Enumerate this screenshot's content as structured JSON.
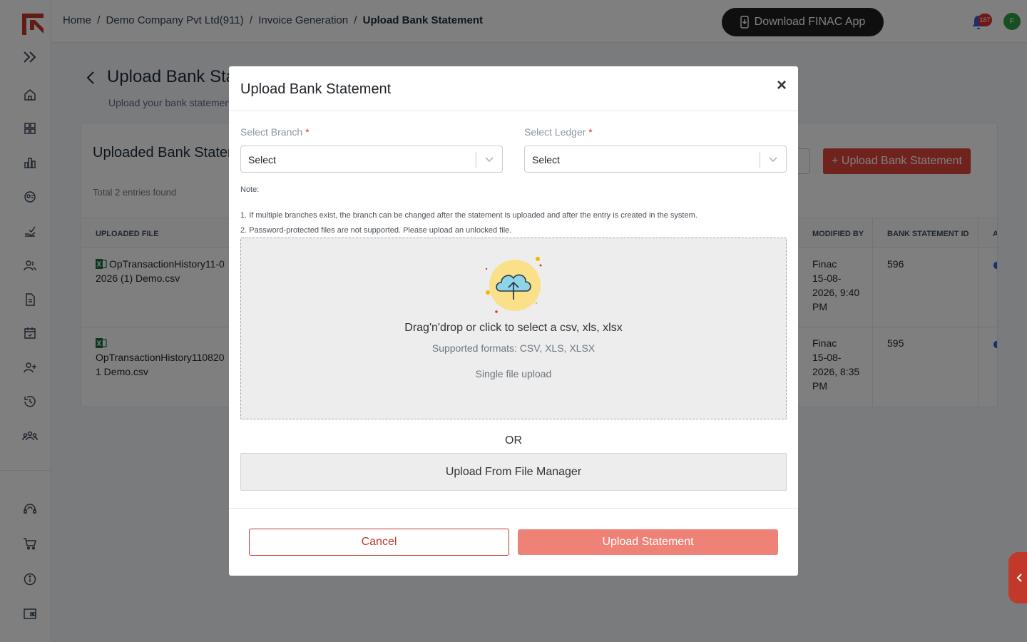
{
  "header": {
    "breadcrumb": [
      {
        "label": "Home"
      },
      {
        "label": "Demo Company Pvt Ltd(911)"
      },
      {
        "label": "Invoice Generation"
      },
      {
        "label": "Upload Bank Statement"
      }
    ],
    "separator": "/",
    "app_button_label": "Download FINAC App",
    "notification_count": "187",
    "avatar_initial": "F"
  },
  "sidebar": {
    "icons": [
      "logo-icon",
      "expand-icon",
      "home-icon",
      "dashboard-icon",
      "reports-icon",
      "accounts-icon",
      "payments-icon",
      "contacts-icon",
      "documents-icon",
      "calendar-icon",
      "add-user-icon",
      "history-icon",
      "team-icon",
      "support-icon",
      "cart-icon",
      "info-icon",
      "wallet-icon"
    ]
  },
  "page": {
    "title": "Upload Bank Sta",
    "subtitle": "Upload your bank statemen",
    "card_title": "Uploaded Bank Stater",
    "entries_count": "Total 2 entries found",
    "upload_button": "+ Upload Bank Statement",
    "columns": {
      "uploaded_file": "UPLOADED FILE",
      "modified_by": "MODIFIED BY",
      "bank_statement_id": "BANK STATEMENT ID",
      "action": "A"
    },
    "rows": [
      {
        "file_line1": "OpTransactionHistory11-0",
        "file_line2": "2026 (1) Demo.csv",
        "modified_by": "Finac",
        "modified_date1": "15-08-",
        "modified_date2": "2026, 9:40",
        "modified_date3": "PM",
        "statement_id": "596"
      },
      {
        "file_line1": "OpTransactionHistory110820",
        "file_line2": "1 Demo.csv",
        "modified_by": "Finac",
        "modified_date1": "15-08-",
        "modified_date2": "2026, 8:35",
        "modified_date3": "PM",
        "statement_id": "595"
      }
    ]
  },
  "modal": {
    "title": "Upload Bank Statement",
    "close": "×",
    "branch_label": "Select Branch",
    "ledger_label": "Select Ledger",
    "required_mark": "*",
    "branch_value": "Select",
    "ledger_value": "Select",
    "note_label": "Note:",
    "note_1": "1. If multiple branches exist, the branch can be changed after the statement is uploaded and after the entry is created in the system.",
    "note_2": "2. Password-protected files are not supported. Please upload an unlocked file.",
    "dropzone_main": "Drag'n'drop or click to select a csv, xls, xlsx",
    "dropzone_formats": "Supported formats: CSV, XLS, XLSX",
    "dropzone_single": "Single file upload",
    "or_label": "OR",
    "file_manager_button": "Upload From File Manager",
    "cancel_button": "Cancel",
    "submit_button": "Upload Statement"
  },
  "colors": {
    "accent": "#e0453a",
    "accent_disabled": "#ee8277",
    "overlay": "rgba(0,0,0,0.5)"
  }
}
